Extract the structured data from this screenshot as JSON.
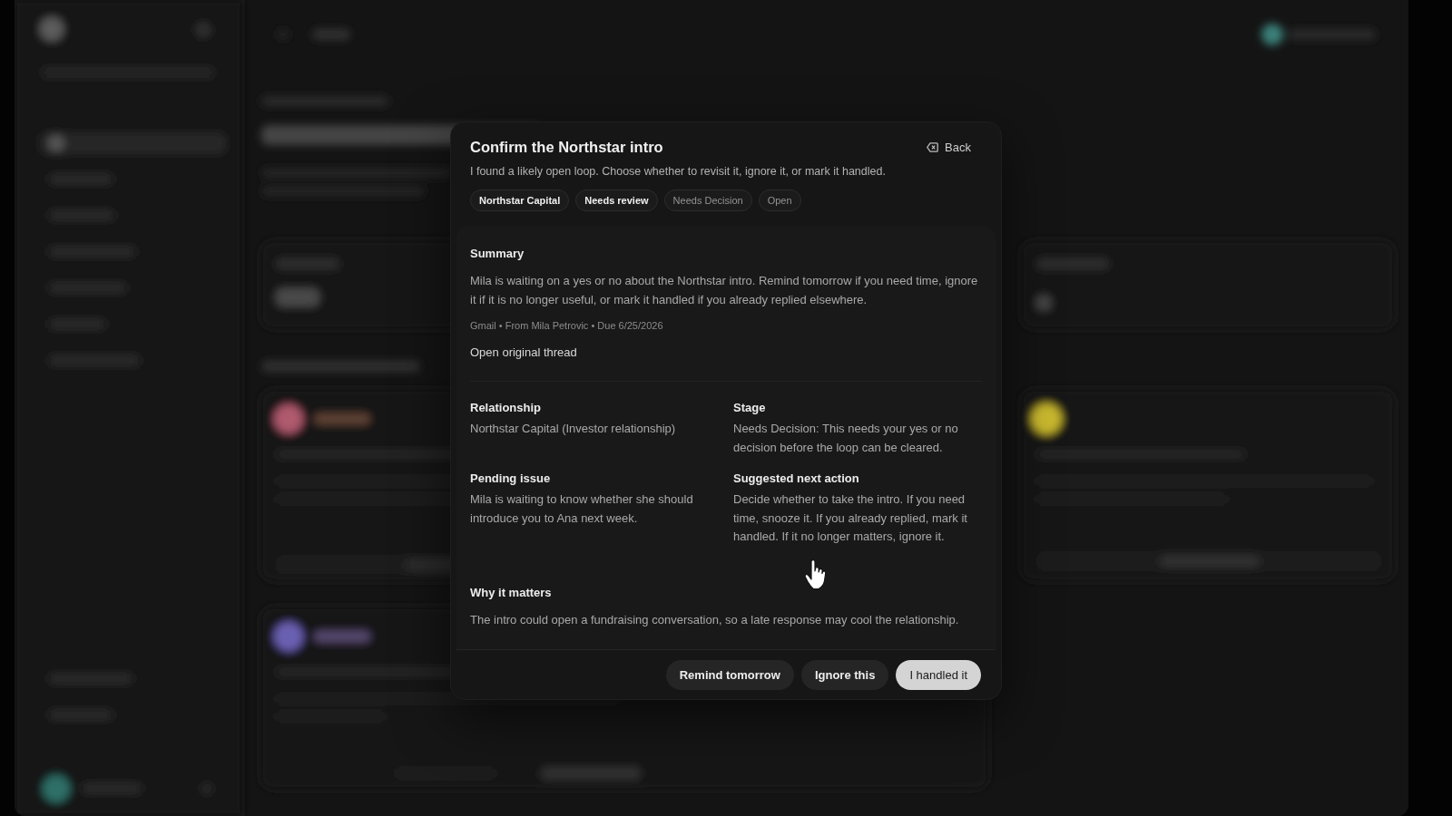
{
  "dialog": {
    "title": "Confirm the Northstar intro",
    "back_button": "Back",
    "description": "I found a likely open loop. Choose whether to revisit it, ignore it, or mark it handled.",
    "tags": [
      {
        "label": "Northstar Capital",
        "highlighted": true
      },
      {
        "label": "Needs review",
        "highlighted": true
      },
      {
        "label": "Needs Decision",
        "highlighted": false
      },
      {
        "label": "Open",
        "highlighted": false
      }
    ],
    "summary": {
      "heading": "Summary",
      "text": "Mila is waiting on a yes or no about the Northstar intro. Remind tomorrow if you need time, ignore it if it is no longer useful, or mark it handled if you already replied elsewhere.",
      "meta": "Gmail • From Mila Petrovic • Due 6/25/2026",
      "link": "Open original thread"
    },
    "details": [
      {
        "label": "Relationship",
        "value": "Northstar Capital (Investor relationship)"
      },
      {
        "label": "Stage",
        "value": "Needs Decision: This needs your yes or no decision before the loop can be cleared."
      },
      {
        "label": "Pending issue",
        "value": "Mila is waiting to know whether she should introduce you to Ana next week."
      },
      {
        "label": "Suggested next action",
        "value": "Decide whether to take the intro. If you need time, snooze it. If you already replied, mark it handled. If it no longer matters, ignore it."
      }
    ],
    "why_it_matters": {
      "heading": "Why it matters",
      "text": "The intro could open a fundraising conversation, so a late response may cool the relationship."
    },
    "actions": [
      {
        "label": "Remind tomorrow",
        "kind": "secondary"
      },
      {
        "label": "Ignore this",
        "kind": "secondary"
      },
      {
        "label": "I handled it",
        "kind": "primary"
      }
    ]
  }
}
